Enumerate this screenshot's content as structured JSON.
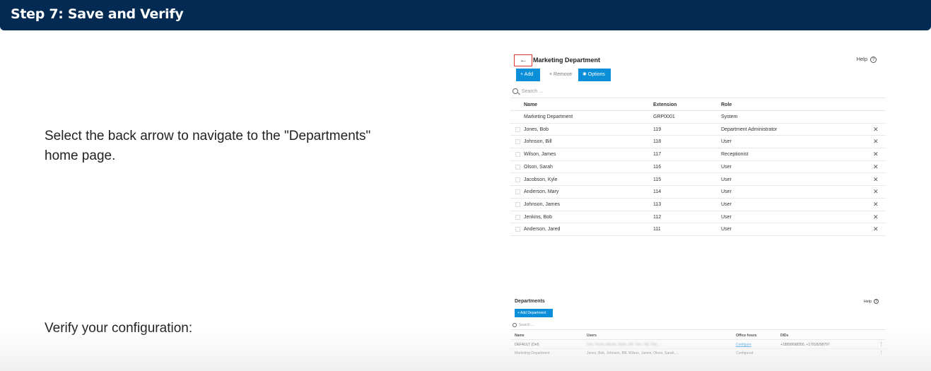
{
  "step": {
    "title": "Step 7: Save and Verify"
  },
  "instructions": [
    "Select the back arrow to navigate to the \"Departments\" home page.",
    "Verify your configuration:"
  ],
  "dept_page": {
    "back_icon": "←",
    "title": "Marketing Department",
    "help_label": "Help",
    "help_icon": "?",
    "toolbar": {
      "add": "+ Add",
      "remove": "× Remove",
      "options": "✱ Options"
    },
    "search_placeholder": "Search ...",
    "columns": {
      "name": "Name",
      "extension": "Extension",
      "role": "Role"
    },
    "rows": [
      {
        "name": "Marketing Department",
        "extension": "GRP0001",
        "role": "System",
        "removable": false
      },
      {
        "name": "Jones, Bob",
        "extension": "119",
        "role": "Department Administrator",
        "removable": true
      },
      {
        "name": "Johnson, Bill",
        "extension": "118",
        "role": "User",
        "removable": true
      },
      {
        "name": "Wilson, James",
        "extension": "117",
        "role": "Receptionist",
        "removable": true
      },
      {
        "name": "Olson, Sarah",
        "extension": "116",
        "role": "User",
        "removable": true
      },
      {
        "name": "Jacobson, Kyle",
        "extension": "115",
        "role": "User",
        "removable": true
      },
      {
        "name": "Anderson, Mary",
        "extension": "114",
        "role": "User",
        "removable": true
      },
      {
        "name": "Johnson, James",
        "extension": "113",
        "role": "User",
        "removable": true
      },
      {
        "name": "Jenkins, Bob",
        "extension": "112",
        "role": "User",
        "removable": true
      },
      {
        "name": "Anderson, Jared",
        "extension": "111",
        "role": "User",
        "removable": true
      }
    ],
    "remove_icon": "✕"
  },
  "departments_page": {
    "title": "Departments",
    "help_label": "Help",
    "help_icon": "?",
    "add_button": "+ Add Department",
    "search_placeholder": "Search ...",
    "columns": {
      "name": "Name",
      "users": "Users",
      "office_hours": "Office hours",
      "dids": "DIDs"
    },
    "rows": [
      {
        "name": "DEFAULT (Def)",
        "users": "Doe, Frank, Abram, Bella, Hill, Tom, Hill, Tom, ...",
        "users_blurred": true,
        "office_hours": "Configure",
        "office_hours_link": true,
        "dids": "+18558698350, +17018299797"
      },
      {
        "name": "Marketing Department",
        "users": "Jones, Bob, Johnson, Bill, Wilson, James, Olson, Sarah, ...",
        "users_blurred": false,
        "office_hours": "Configured",
        "office_hours_link": false,
        "dids": ""
      }
    ],
    "more_icon": "⋮"
  },
  "colors": {
    "header_bg": "#032a52",
    "accent": "#0b8fd8",
    "highlight_red": "#d93a32"
  }
}
